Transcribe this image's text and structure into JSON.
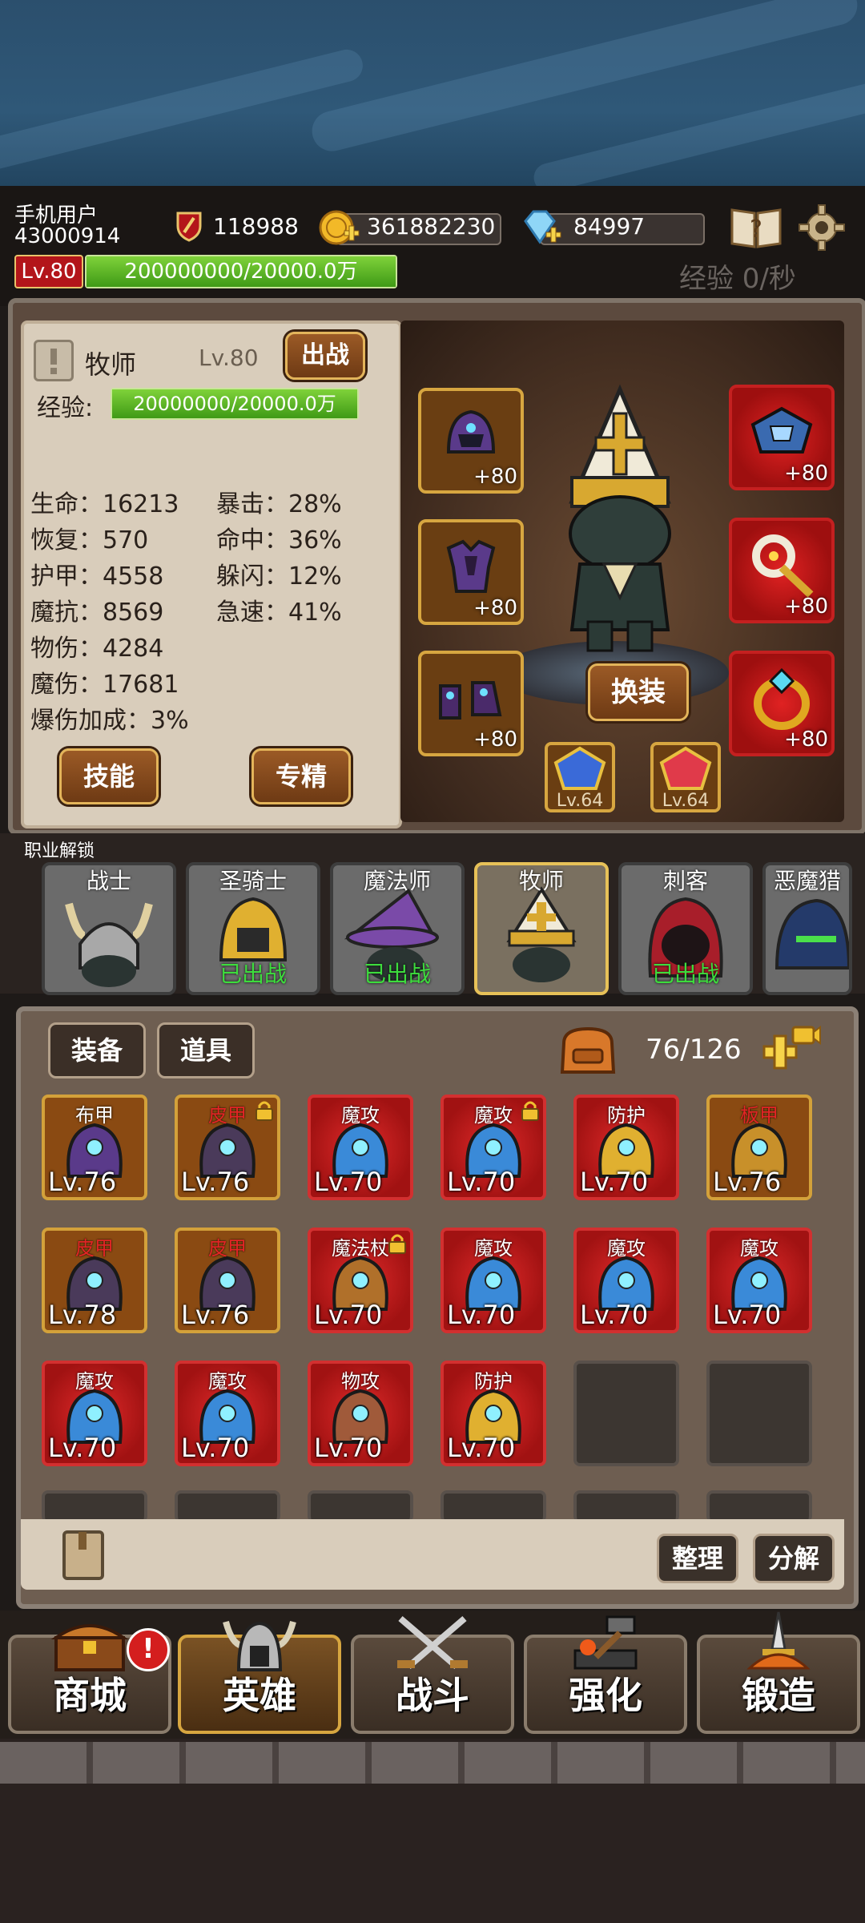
{
  "header": {
    "username": "手机用户",
    "user_id": "43000914",
    "combat_power": "118988",
    "gold": "361882230",
    "diamonds": "84997",
    "level_badge": "Lv.80",
    "xp_bar_text": "200000000/20000.0万",
    "xp_fill": 1.0,
    "xp_rate": "经验 0/秒"
  },
  "hero": {
    "class_name": "牧师",
    "level": "Lv.80",
    "deploy_button": "出战",
    "exp_label": "经验:",
    "exp_bar_text": "20000000/20000.0万",
    "stats_left": [
      "生命：16213",
      "恢复：570",
      "护甲：4558",
      "魔抗：8569",
      "物伤：4284",
      "魔伤：17681",
      "爆伤加成：3%"
    ],
    "stats_right": [
      "暴击：28%",
      "命中：36%",
      "躲闪：12%",
      "急速：41%"
    ],
    "skill_button": "技能",
    "specialize_button": "专精",
    "change_outfit_button": "换装",
    "equip_left": [
      {
        "name": "helmet-icon",
        "plus": "+80"
      },
      {
        "name": "armor-icon",
        "plus": "+80"
      },
      {
        "name": "boots-icon",
        "plus": "+80"
      }
    ],
    "equip_right": [
      {
        "name": "spellbook-icon",
        "plus": "+80"
      },
      {
        "name": "amulet-icon",
        "plus": "+80"
      },
      {
        "name": "ring-icon",
        "plus": "+80"
      }
    ],
    "gems": [
      {
        "name": "blue-gem-icon",
        "level": "Lv.64"
      },
      {
        "name": "red-gem-icon",
        "level": "Lv.64"
      }
    ]
  },
  "class_unlock": {
    "title": "职业解锁",
    "classes": [
      {
        "name": "战士",
        "status": ""
      },
      {
        "name": "圣骑士",
        "status": "已出战"
      },
      {
        "name": "魔法师",
        "status": "已出战"
      },
      {
        "name": "牧师",
        "status": ""
      },
      {
        "name": "刺客",
        "status": "已出战"
      },
      {
        "name": "恶魔猎",
        "status": ""
      }
    ]
  },
  "inventory": {
    "tab_equipment": "装备",
    "tab_items": "道具",
    "capacity": "76/126",
    "sort_button": "整理",
    "decompose_button": "分解",
    "items": [
      {
        "type": "布甲",
        "level": "Lv.76",
        "style": "gold",
        "red": false,
        "locked": false
      },
      {
        "type": "皮甲",
        "level": "Lv.76",
        "style": "gold",
        "red": true,
        "locked": true
      },
      {
        "type": "魔攻",
        "level": "Lv.70",
        "style": "red",
        "red": false,
        "locked": false
      },
      {
        "type": "魔攻",
        "level": "Lv.70",
        "style": "red",
        "red": false,
        "locked": true
      },
      {
        "type": "防护",
        "level": "Lv.70",
        "style": "red",
        "red": false,
        "locked": false
      },
      {
        "type": "板甲",
        "level": "Lv.76",
        "style": "gold",
        "red": true,
        "locked": false
      },
      {
        "type": "皮甲",
        "level": "Lv.78",
        "style": "gold",
        "red": true,
        "locked": false
      },
      {
        "type": "皮甲",
        "level": "Lv.76",
        "style": "gold",
        "red": true,
        "locked": false
      },
      {
        "type": "魔法杖",
        "level": "Lv.70",
        "style": "red",
        "red": false,
        "locked": true
      },
      {
        "type": "魔攻",
        "level": "Lv.70",
        "style": "red",
        "red": false,
        "locked": false
      },
      {
        "type": "魔攻",
        "level": "Lv.70",
        "style": "red",
        "red": false,
        "locked": false
      },
      {
        "type": "魔攻",
        "level": "Lv.70",
        "style": "red",
        "red": false,
        "locked": false
      },
      {
        "type": "魔攻",
        "level": "Lv.70",
        "style": "red",
        "red": false,
        "locked": false
      },
      {
        "type": "魔攻",
        "level": "Lv.70",
        "style": "red",
        "red": false,
        "locked": false
      },
      {
        "type": "物攻",
        "level": "Lv.70",
        "style": "red",
        "red": false,
        "locked": false
      },
      {
        "type": "防护",
        "level": "Lv.70",
        "style": "red",
        "red": false,
        "locked": false
      },
      {
        "type": "",
        "level": "",
        "style": "empty",
        "red": false,
        "locked": false
      },
      {
        "type": "",
        "level": "",
        "style": "empty",
        "red": false,
        "locked": false
      }
    ]
  },
  "nav": {
    "shop": "商城",
    "hero": "英雄",
    "battle": "战斗",
    "enhance": "强化",
    "forge": "锻造",
    "shop_badge": "!"
  }
}
